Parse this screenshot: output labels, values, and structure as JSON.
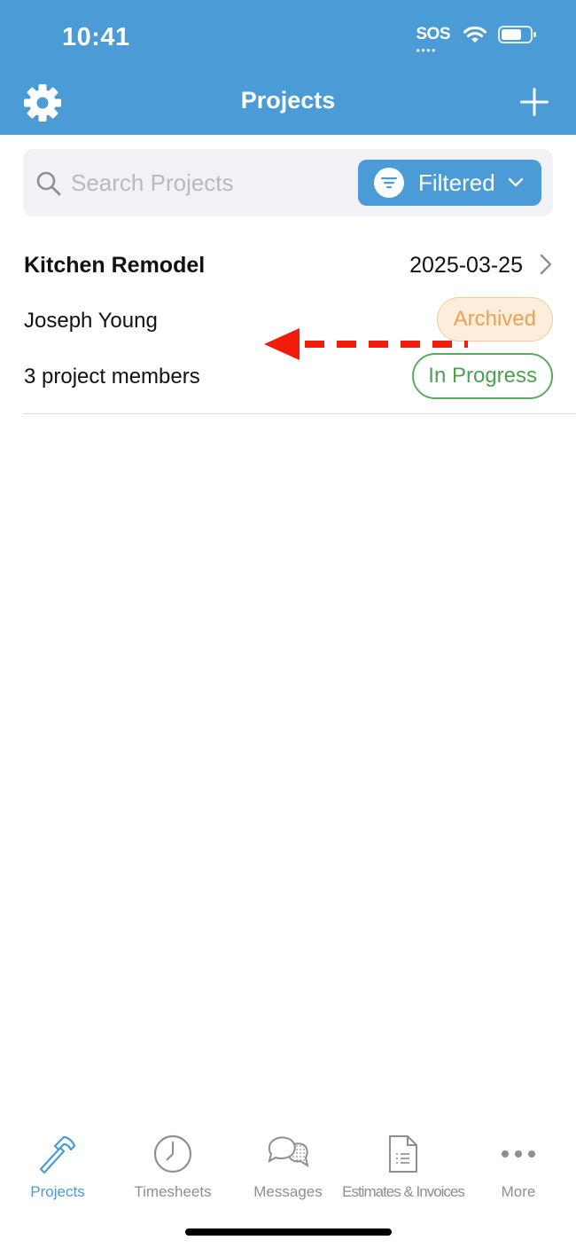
{
  "status_bar": {
    "time": "10:41",
    "sos": "SOS",
    "icons": [
      "wifi-icon",
      "battery-icon"
    ]
  },
  "nav": {
    "title": "Projects",
    "left_icon": "gear-icon",
    "right_icon": "plus-icon"
  },
  "search": {
    "placeholder": "Search Projects",
    "value": "",
    "filter_label": "Filtered"
  },
  "project": {
    "title": "Kitchen Remodel",
    "date": "2025-03-25",
    "owner": "Joseph Young",
    "members": "3 project members",
    "status_archived": "Archived",
    "status_progress": "In Progress"
  },
  "tabs": [
    {
      "label": "Projects",
      "icon": "hammer-icon",
      "active": true
    },
    {
      "label": "Timesheets",
      "icon": "clock-icon",
      "active": false
    },
    {
      "label": "Messages",
      "icon": "chat-bubbles-icon",
      "active": false
    },
    {
      "label": "Estimates & Invoices",
      "icon": "document-icon",
      "active": false
    },
    {
      "label": "More",
      "icon": "more-dots-icon",
      "active": false
    }
  ],
  "colors": {
    "header": "#4b9bd6",
    "accent": "#4b9bd6",
    "archived_text": "#f0a055",
    "archived_bg": "#fdeedc",
    "progress": "#4e9f52",
    "annotation_arrow": "#f21c0a"
  }
}
